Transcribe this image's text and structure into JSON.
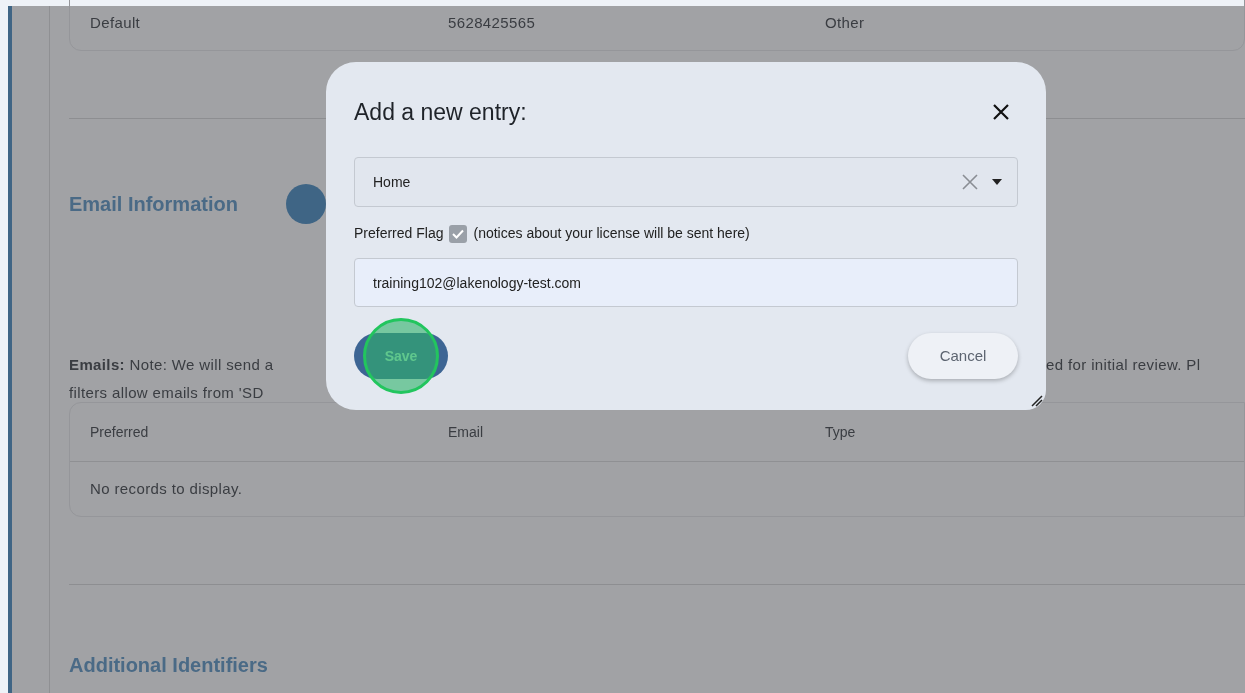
{
  "page": {
    "top_row": [
      "Default",
      "5628425565",
      "Other"
    ],
    "email_section": {
      "heading": "Email Information",
      "note_left": "**Emails:** Note: We will send a",
      "note_right": "ed for initial review. Pl",
      "note_line_2": "filters allow emails from 'SD",
      "table": {
        "columns": [
          "Preferred",
          "Email",
          "Type"
        ],
        "empty_message": "No records to display."
      }
    },
    "next_heading": "Additional Identifiers"
  },
  "dialog": {
    "title": "Add a new entry:",
    "type_select": {
      "value": "Home"
    },
    "preferred_flag": {
      "label": "Preferred Flag",
      "checked": true,
      "hint": "(notices about your license will be sent here)"
    },
    "email_field": {
      "value": "training102@lakenology-test.com"
    },
    "buttons": [
      {
        "kind": "primary",
        "label": "Save",
        "highlighted": true
      },
      {
        "kind": "secondary",
        "label": "Cancel",
        "highlighted": false
      }
    ]
  }
}
